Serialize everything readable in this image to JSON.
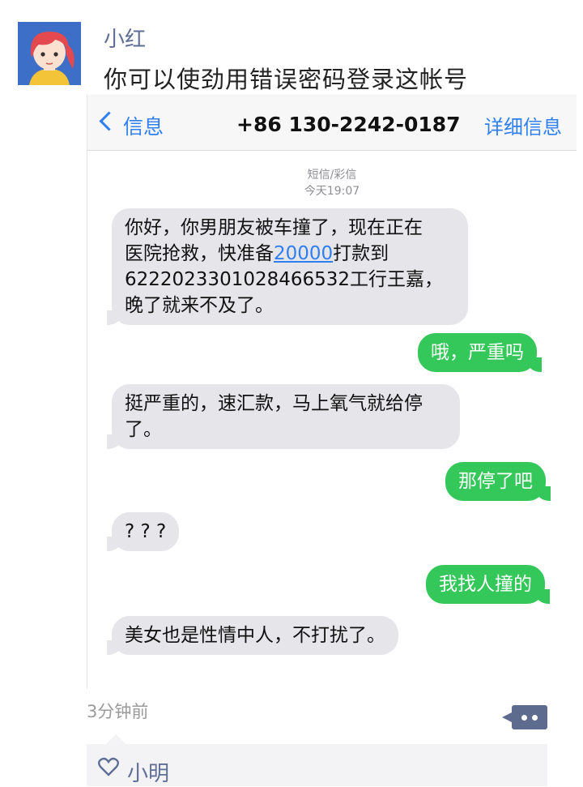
{
  "post": {
    "username": "小红",
    "text": "你可以使劲用错误密码登录这帐号",
    "time": "3分钟前",
    "liker": "小明"
  },
  "screenshot": {
    "nav": {
      "back_label": "信息",
      "title": "+86 130-2242-0187",
      "detail": "详细信息"
    },
    "meta_type": "短信/彩信",
    "meta_time": "今天19:07",
    "messages": [
      {
        "dir": "in",
        "lines": [
          "你好，你男朋友被车撞了，现在正在",
          "医院抢救，快准备",
          "20000",
          "打款到",
          "6222023301028466532工行王嘉，",
          "晚了就来不及了。"
        ]
      },
      {
        "dir": "out",
        "text": "哦，严重吗"
      },
      {
        "dir": "in",
        "lines": [
          "挺严重的，速汇款，马上氧气就给停",
          "了。"
        ]
      },
      {
        "dir": "out",
        "text": "那停了吧"
      },
      {
        "dir": "in",
        "text": "? ? ?"
      },
      {
        "dir": "out",
        "text": "我找人撞的"
      },
      {
        "dir": "in",
        "text": "美女也是性情中人，不打扰了。"
      }
    ]
  },
  "colors": {
    "link": "#5e6e95",
    "ios_blue": "#2f7ff0",
    "bubble_green": "#34c759",
    "bubble_gray": "#e5e5ea"
  },
  "icons": [
    "avatar",
    "chevron-left-icon",
    "comment-icon",
    "heart-icon"
  ]
}
